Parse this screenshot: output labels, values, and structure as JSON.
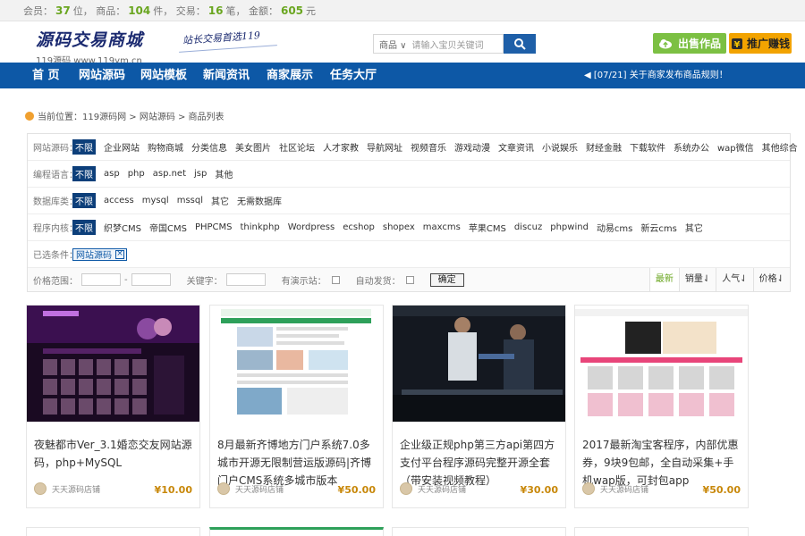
{
  "stats": {
    "members_label": "会员：",
    "members_value": "37",
    "members_unit": "位，",
    "products_label": "商品：",
    "products_value": "104",
    "products_unit": "件，",
    "deals_label": "交易：",
    "deals_value": "16",
    "deals_unit": "笔，",
    "amount_label": "金额：",
    "amount_value": "605",
    "amount_unit": "元"
  },
  "header": {
    "logo_main": "源码交易商城",
    "logo_sub": "119源码   www.119ym.cn",
    "slogan": "站长交易首选119",
    "search_select": "商品",
    "search_placeholder": "请输入宝贝关键词",
    "sell_button": "出售作品",
    "promo_button": "推广赚钱",
    "sell_icon": "upload-cloud-icon",
    "promo_icon": "money-bag-icon",
    "search_icon": "search-icon"
  },
  "nav": {
    "items": [
      "首 页",
      "网站源码",
      "网站模板",
      "新闻资讯",
      "商家展示",
      "任务大厅"
    ],
    "notice": "[07/21] 关于商家发布商品规则！"
  },
  "breadcrumb": "当前位置：119源码网 > 网站源码 > 商品列表",
  "filters": {
    "site_source": {
      "label": "网站源码：",
      "options": [
        "不限",
        "企业网站",
        "购物商城",
        "分类信息",
        "美女图片",
        "社区论坛",
        "人才家教",
        "导航网址",
        "视频音乐",
        "游戏动漫",
        "文章资讯",
        "小说娱乐",
        "财经金融",
        "下载软件",
        "系统办公",
        "wap微信",
        "其他综合"
      ]
    },
    "language": {
      "label": "编程语言：",
      "options": [
        "不限",
        "asp",
        "php",
        "asp.net",
        "jsp",
        "其他"
      ]
    },
    "database": {
      "label": "数据库类：",
      "options": [
        "不限",
        "access",
        "mysql",
        "mssql",
        "其它",
        "无需数据库"
      ]
    },
    "core": {
      "label": "程序内核：",
      "options": [
        "不限",
        "织梦CMS",
        "帝国CMS",
        "PHPCMS",
        "thinkphp",
        "Wordpress",
        "ecshop",
        "shopex",
        "maxcms",
        "苹果CMS",
        "discuz",
        "phpwind",
        "动易cms",
        "新云cms",
        "其它"
      ]
    },
    "selected": {
      "label": "已选条件：",
      "chip": "网站源码",
      "chip_close": "×"
    },
    "bar": {
      "price_label": "价格范围：",
      "dash": "-",
      "keyword_label": "关键字：",
      "demo_label": "有演示站：",
      "auto_label": "自动发货：",
      "confirm": "确定",
      "sorts": [
        "最新",
        "销量⇃",
        "人气⇃",
        "价格⇃"
      ]
    }
  },
  "products": [
    {
      "title": "夜魅都市Ver_3.1婚恋交友网站源码，php+MySQL",
      "shop": "天天源码店铺",
      "price": "¥10.00"
    },
    {
      "title": "8月最新齐博地方门户系统7.0多城市开源无限制营运版源码|齐博门户CMS系统多城市版本",
      "shop": "天天源码店铺",
      "price": "¥50.00"
    },
    {
      "title": "企业级正规php第三方api第四方支付平台程序源码完整开源全套（带安装视频教程）",
      "shop": "天天源码店铺",
      "price": "¥30.00"
    },
    {
      "title": "2017最新淘宝客程序，内部优惠券，9块9包邮，全自动采集+手机wap版，可封包app",
      "shop": "天天源码店铺",
      "price": "¥50.00"
    }
  ],
  "colors": {
    "nav_blue": "#0d58a6",
    "price": "#c8880a",
    "stat_green": "#6aa620",
    "sell_green": "#7cc043",
    "promo_orange": "#f2a300"
  }
}
